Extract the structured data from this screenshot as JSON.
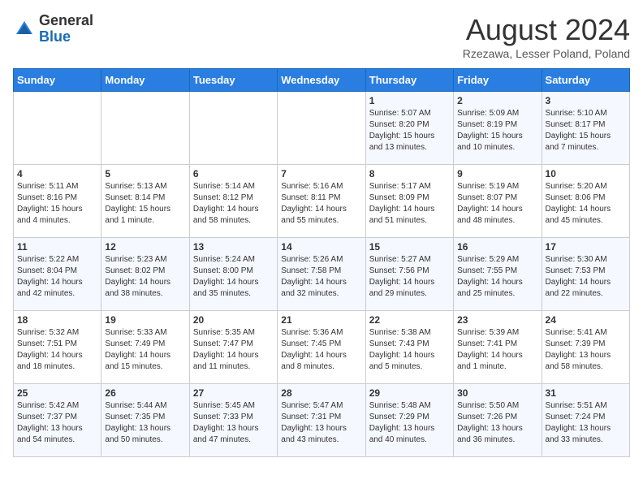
{
  "header": {
    "logo_general": "General",
    "logo_blue": "Blue",
    "month_title": "August 2024",
    "location": "Rzezawa, Lesser Poland, Poland"
  },
  "days_of_week": [
    "Sunday",
    "Monday",
    "Tuesday",
    "Wednesday",
    "Thursday",
    "Friday",
    "Saturday"
  ],
  "weeks": [
    [
      {
        "day": "",
        "sunrise": "",
        "sunset": "",
        "daylight": ""
      },
      {
        "day": "",
        "sunrise": "",
        "sunset": "",
        "daylight": ""
      },
      {
        "day": "",
        "sunrise": "",
        "sunset": "",
        "daylight": ""
      },
      {
        "day": "",
        "sunrise": "",
        "sunset": "",
        "daylight": ""
      },
      {
        "day": "1",
        "sunrise": "Sunrise: 5:07 AM",
        "sunset": "Sunset: 8:20 PM",
        "daylight": "Daylight: 15 hours and 13 minutes."
      },
      {
        "day": "2",
        "sunrise": "Sunrise: 5:09 AM",
        "sunset": "Sunset: 8:19 PM",
        "daylight": "Daylight: 15 hours and 10 minutes."
      },
      {
        "day": "3",
        "sunrise": "Sunrise: 5:10 AM",
        "sunset": "Sunset: 8:17 PM",
        "daylight": "Daylight: 15 hours and 7 minutes."
      }
    ],
    [
      {
        "day": "4",
        "sunrise": "Sunrise: 5:11 AM",
        "sunset": "Sunset: 8:16 PM",
        "daylight": "Daylight: 15 hours and 4 minutes."
      },
      {
        "day": "5",
        "sunrise": "Sunrise: 5:13 AM",
        "sunset": "Sunset: 8:14 PM",
        "daylight": "Daylight: 15 hours and 1 minute."
      },
      {
        "day": "6",
        "sunrise": "Sunrise: 5:14 AM",
        "sunset": "Sunset: 8:12 PM",
        "daylight": "Daylight: 14 hours and 58 minutes."
      },
      {
        "day": "7",
        "sunrise": "Sunrise: 5:16 AM",
        "sunset": "Sunset: 8:11 PM",
        "daylight": "Daylight: 14 hours and 55 minutes."
      },
      {
        "day": "8",
        "sunrise": "Sunrise: 5:17 AM",
        "sunset": "Sunset: 8:09 PM",
        "daylight": "Daylight: 14 hours and 51 minutes."
      },
      {
        "day": "9",
        "sunrise": "Sunrise: 5:19 AM",
        "sunset": "Sunset: 8:07 PM",
        "daylight": "Daylight: 14 hours and 48 minutes."
      },
      {
        "day": "10",
        "sunrise": "Sunrise: 5:20 AM",
        "sunset": "Sunset: 8:06 PM",
        "daylight": "Daylight: 14 hours and 45 minutes."
      }
    ],
    [
      {
        "day": "11",
        "sunrise": "Sunrise: 5:22 AM",
        "sunset": "Sunset: 8:04 PM",
        "daylight": "Daylight: 14 hours and 42 minutes."
      },
      {
        "day": "12",
        "sunrise": "Sunrise: 5:23 AM",
        "sunset": "Sunset: 8:02 PM",
        "daylight": "Daylight: 14 hours and 38 minutes."
      },
      {
        "day": "13",
        "sunrise": "Sunrise: 5:24 AM",
        "sunset": "Sunset: 8:00 PM",
        "daylight": "Daylight: 14 hours and 35 minutes."
      },
      {
        "day": "14",
        "sunrise": "Sunrise: 5:26 AM",
        "sunset": "Sunset: 7:58 PM",
        "daylight": "Daylight: 14 hours and 32 minutes."
      },
      {
        "day": "15",
        "sunrise": "Sunrise: 5:27 AM",
        "sunset": "Sunset: 7:56 PM",
        "daylight": "Daylight: 14 hours and 29 minutes."
      },
      {
        "day": "16",
        "sunrise": "Sunrise: 5:29 AM",
        "sunset": "Sunset: 7:55 PM",
        "daylight": "Daylight: 14 hours and 25 minutes."
      },
      {
        "day": "17",
        "sunrise": "Sunrise: 5:30 AM",
        "sunset": "Sunset: 7:53 PM",
        "daylight": "Daylight: 14 hours and 22 minutes."
      }
    ],
    [
      {
        "day": "18",
        "sunrise": "Sunrise: 5:32 AM",
        "sunset": "Sunset: 7:51 PM",
        "daylight": "Daylight: 14 hours and 18 minutes."
      },
      {
        "day": "19",
        "sunrise": "Sunrise: 5:33 AM",
        "sunset": "Sunset: 7:49 PM",
        "daylight": "Daylight: 14 hours and 15 minutes."
      },
      {
        "day": "20",
        "sunrise": "Sunrise: 5:35 AM",
        "sunset": "Sunset: 7:47 PM",
        "daylight": "Daylight: 14 hours and 11 minutes."
      },
      {
        "day": "21",
        "sunrise": "Sunrise: 5:36 AM",
        "sunset": "Sunset: 7:45 PM",
        "daylight": "Daylight: 14 hours and 8 minutes."
      },
      {
        "day": "22",
        "sunrise": "Sunrise: 5:38 AM",
        "sunset": "Sunset: 7:43 PM",
        "daylight": "Daylight: 14 hours and 5 minutes."
      },
      {
        "day": "23",
        "sunrise": "Sunrise: 5:39 AM",
        "sunset": "Sunset: 7:41 PM",
        "daylight": "Daylight: 14 hours and 1 minute."
      },
      {
        "day": "24",
        "sunrise": "Sunrise: 5:41 AM",
        "sunset": "Sunset: 7:39 PM",
        "daylight": "Daylight: 13 hours and 58 minutes."
      }
    ],
    [
      {
        "day": "25",
        "sunrise": "Sunrise: 5:42 AM",
        "sunset": "Sunset: 7:37 PM",
        "daylight": "Daylight: 13 hours and 54 minutes."
      },
      {
        "day": "26",
        "sunrise": "Sunrise: 5:44 AM",
        "sunset": "Sunset: 7:35 PM",
        "daylight": "Daylight: 13 hours and 50 minutes."
      },
      {
        "day": "27",
        "sunrise": "Sunrise: 5:45 AM",
        "sunset": "Sunset: 7:33 PM",
        "daylight": "Daylight: 13 hours and 47 minutes."
      },
      {
        "day": "28",
        "sunrise": "Sunrise: 5:47 AM",
        "sunset": "Sunset: 7:31 PM",
        "daylight": "Daylight: 13 hours and 43 minutes."
      },
      {
        "day": "29",
        "sunrise": "Sunrise: 5:48 AM",
        "sunset": "Sunset: 7:29 PM",
        "daylight": "Daylight: 13 hours and 40 minutes."
      },
      {
        "day": "30",
        "sunrise": "Sunrise: 5:50 AM",
        "sunset": "Sunset: 7:26 PM",
        "daylight": "Daylight: 13 hours and 36 minutes."
      },
      {
        "day": "31",
        "sunrise": "Sunrise: 5:51 AM",
        "sunset": "Sunset: 7:24 PM",
        "daylight": "Daylight: 13 hours and 33 minutes."
      }
    ]
  ]
}
